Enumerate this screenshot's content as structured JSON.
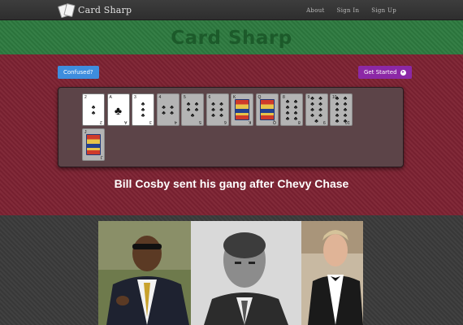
{
  "nav": {
    "brand": "Card Sharp",
    "links": [
      "About",
      "Sign In",
      "Sign Up"
    ]
  },
  "header": {
    "title": "Card Sharp"
  },
  "buttons": {
    "confused": "Confused?",
    "get_started": "Get Started"
  },
  "cards": [
    {
      "rank": "2",
      "suit": "clubs",
      "highlighted": true
    },
    {
      "rank": "A",
      "suit": "clubs",
      "highlighted": true
    },
    {
      "rank": "3",
      "suit": "clubs",
      "highlighted": true
    },
    {
      "rank": "4",
      "suit": "clubs",
      "highlighted": false
    },
    {
      "rank": "5",
      "suit": "clubs",
      "highlighted": false
    },
    {
      "rank": "6",
      "suit": "clubs",
      "highlighted": false
    },
    {
      "rank": "K",
      "suit": "clubs",
      "highlighted": false
    },
    {
      "rank": "Q",
      "suit": "clubs",
      "highlighted": false
    },
    {
      "rank": "8",
      "suit": "clubs",
      "highlighted": false
    },
    {
      "rank": "9",
      "suit": "clubs",
      "highlighted": false
    },
    {
      "rank": "10",
      "suit": "clubs",
      "highlighted": false
    },
    {
      "rank": "J",
      "suit": "clubs",
      "highlighted": false
    }
  ],
  "phrase": "Bill Cosby sent his gang after Chevy Chase",
  "colors": {
    "header_green": "#2d7a3f",
    "section_red": "#7d2232",
    "confused_blue": "#3e8dde",
    "start_purple": "#8c28a6"
  },
  "icons": {
    "brand": "playing-cards-icon",
    "get_started": "arrow-circle-right-icon",
    "suit": "club-icon"
  }
}
